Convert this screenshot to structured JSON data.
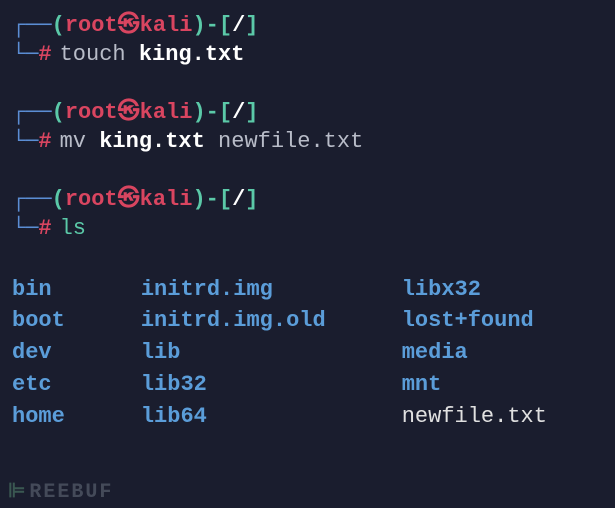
{
  "prompts": [
    {
      "user": "root",
      "host": "kali",
      "path": "/",
      "command": "touch",
      "args_bold": "king.txt",
      "args_plain": ""
    },
    {
      "user": "root",
      "host": "kali",
      "path": "/",
      "command": "mv",
      "args_bold": "king.txt",
      "args_plain": "newfile.txt"
    },
    {
      "user": "root",
      "host": "kali",
      "path": "/",
      "command": "ls",
      "args_bold": "",
      "args_plain": ""
    }
  ],
  "ls_output": {
    "col1": [
      {
        "name": "bin",
        "type": "dir"
      },
      {
        "name": "boot",
        "type": "dir"
      },
      {
        "name": "dev",
        "type": "dir"
      },
      {
        "name": "etc",
        "type": "dir"
      },
      {
        "name": "home",
        "type": "dir"
      }
    ],
    "col2": [
      {
        "name": "initrd.img",
        "type": "dir"
      },
      {
        "name": "initrd.img.old",
        "type": "dir"
      },
      {
        "name": "lib",
        "type": "dir"
      },
      {
        "name": "lib32",
        "type": "dir"
      },
      {
        "name": "lib64",
        "type": "dir"
      }
    ],
    "col3": [
      {
        "name": "libx32",
        "type": "dir"
      },
      {
        "name": "lost+found",
        "type": "dir"
      },
      {
        "name": "media",
        "type": "dir"
      },
      {
        "name": "mnt",
        "type": "dir"
      },
      {
        "name": "newfile.txt",
        "type": "file"
      }
    ]
  },
  "watermark": "REEBUF",
  "symbols": {
    "corner_top": "┌──",
    "corner_bottom": "└─",
    "paren_open": "(",
    "paren_close": ")",
    "bracket_open": "[",
    "bracket_close": "]",
    "dash": "-",
    "hash": "#",
    "skull": "㉿"
  }
}
